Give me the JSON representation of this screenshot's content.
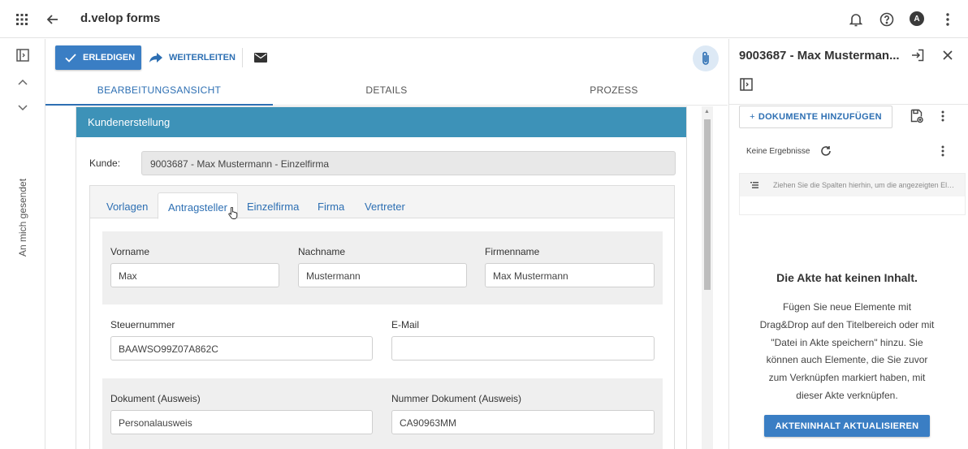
{
  "header": {
    "title": "d.velop forms",
    "avatar_letter": "A"
  },
  "rail": {
    "label": "An mich gesendet"
  },
  "toolbar": {
    "done_label": "ERLEDIGEN",
    "forward_label": "WEITERLEITEN"
  },
  "tabs": [
    {
      "label": "BEARBEITUNGSANSICHT",
      "active": true
    },
    {
      "label": "DETAILS",
      "active": false
    },
    {
      "label": "PROZESS",
      "active": false
    }
  ],
  "form": {
    "header": "Kundenerstellung",
    "kunde_label": "Kunde:",
    "kunde_value": "9003687 - Max Mustermann - Einzelfirma",
    "inner_tabs": [
      "Vorlagen",
      "Antragsteller",
      "Einzelfirma",
      "Firma",
      "Vertreter"
    ],
    "active_inner_tab": "Antragsteller",
    "fields": {
      "vorname": {
        "label": "Vorname",
        "value": "Max"
      },
      "nachname": {
        "label": "Nachname",
        "value": "Mustermann"
      },
      "firmenname": {
        "label": "Firmenname",
        "value": "Max Mustermann"
      },
      "steuernummer": {
        "label": "Steuernummer",
        "value": "BAAWSO99Z07A862C"
      },
      "email": {
        "label": "E-Mail",
        "value": ""
      },
      "dokument": {
        "label": "Dokument (Ausweis)",
        "value": "Personalausweis"
      },
      "nummer_dokument": {
        "label": "Nummer Dokument (Ausweis)",
        "value": "CA90963MM"
      }
    }
  },
  "panel": {
    "title": "9003687 - Max Musterman...",
    "add_docs_label": "DOKUMENTE HINZUFÜGEN",
    "no_results": "Keine Ergebnisse",
    "drag_hint": "Ziehen Sie die Spalten hierhin, um die angezeigten Elemente zu gruppieren",
    "empty_title": "Die Akte hat keinen Inhalt.",
    "empty_text": "Fügen Sie neue Elemente mit Drag&Drop auf den Titelbereich oder mit \"Datei in Akte speichern\" hinzu. Sie können auch Elemente, die Sie zuvor zum Verknüpfen markiert haben, mit dieser Akte verknüpfen.",
    "refresh_label": "AKTENINHALT AKTUALISIEREN"
  },
  "colors": {
    "primary": "#3a7ec4",
    "link": "#2d6fb3",
    "form_header": "#3d92b8"
  },
  "icons": [
    "apps-grid-icon",
    "back-arrow-icon",
    "bell-icon",
    "help-icon",
    "more-vert-icon",
    "panel-toggle-icon",
    "chevron-up-icon",
    "chevron-down-icon",
    "check-icon",
    "forward-arrow-icon",
    "mail-icon",
    "paperclip-icon",
    "export-icon",
    "close-icon",
    "save-to-file-icon",
    "refresh-icon",
    "group-list-icon"
  ]
}
